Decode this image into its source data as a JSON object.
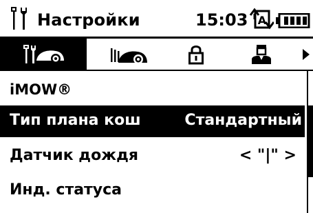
{
  "status_bar": {
    "title": "Настройки",
    "time": "15:03",
    "icons": [
      "settings-icon",
      "autolock-icon",
      "battery-icon"
    ]
  },
  "tabs": [
    {
      "icon": "settings-mower-icon",
      "active": true
    },
    {
      "icon": "mower-dock-icon",
      "active": false
    },
    {
      "icon": "lock-icon",
      "active": false
    },
    {
      "icon": "user-icon",
      "active": false
    }
  ],
  "tab_more_icon": "arrow-right-icon",
  "section": {
    "title": "iMOW®"
  },
  "menu": [
    {
      "label": "Тип плана кош",
      "value": "Стандартный",
      "selected": true
    },
    {
      "label": "Датчик дождя",
      "value": "< \"|\" >",
      "selected": false
    },
    {
      "label": "Инд. статуса",
      "value": "",
      "selected": false
    }
  ],
  "colors": {
    "foreground": "#000000",
    "background": "#ffffff",
    "selected_bg": "#000000",
    "selected_fg": "#ffffff"
  }
}
